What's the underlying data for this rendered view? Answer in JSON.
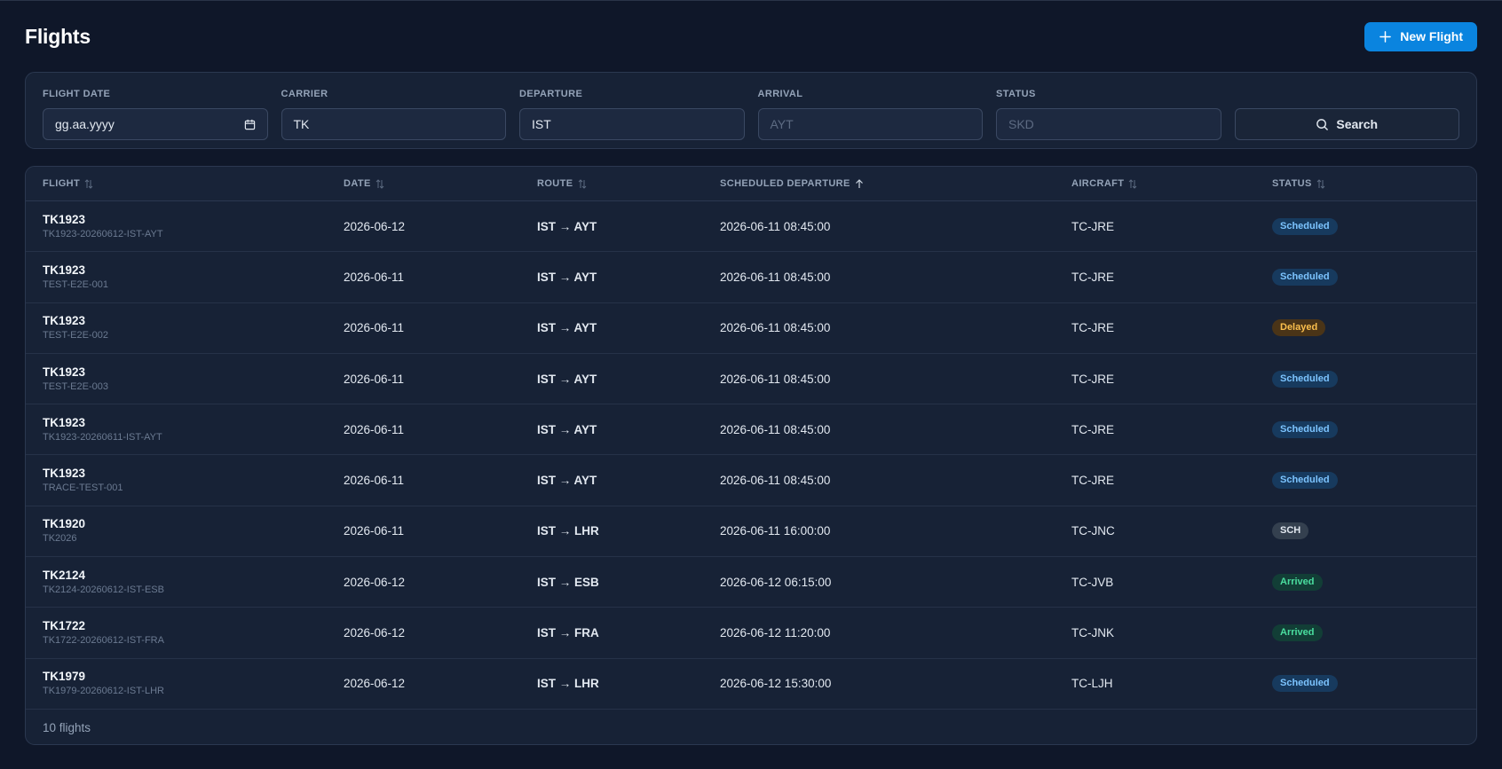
{
  "header": {
    "title": "Flights",
    "new_button": "New Flight"
  },
  "filters": {
    "flight_date": {
      "label": "FLIGHT DATE",
      "value": "gg.aa.yyyy"
    },
    "carrier": {
      "label": "CARRIER",
      "value": "TK"
    },
    "departure": {
      "label": "DEPARTURE",
      "value": "IST"
    },
    "arrival": {
      "label": "ARRIVAL",
      "placeholder": "AYT"
    },
    "status": {
      "label": "STATUS",
      "placeholder": "SKD"
    },
    "search_button": "Search"
  },
  "table": {
    "columns": [
      "FLIGHT",
      "DATE",
      "ROUTE",
      "SCHEDULED DEPARTURE",
      "AIRCRAFT",
      "STATUS"
    ],
    "rows": [
      {
        "flight": "TK1923",
        "id": "TK1923-20260612-IST-AYT",
        "date": "2026-06-12",
        "route": "IST → AYT",
        "departure": "2026-06-11 08:45:00",
        "aircraft": "TC-JRE",
        "status": "Scheduled",
        "status_type": "scheduled"
      },
      {
        "flight": "TK1923",
        "id": "TEST-E2E-001",
        "date": "2026-06-11",
        "route": "IST → AYT",
        "departure": "2026-06-11 08:45:00",
        "aircraft": "TC-JRE",
        "status": "Scheduled",
        "status_type": "scheduled"
      },
      {
        "flight": "TK1923",
        "id": "TEST-E2E-002",
        "date": "2026-06-11",
        "route": "IST → AYT",
        "departure": "2026-06-11 08:45:00",
        "aircraft": "TC-JRE",
        "status": "Delayed",
        "status_type": "delayed"
      },
      {
        "flight": "TK1923",
        "id": "TEST-E2E-003",
        "date": "2026-06-11",
        "route": "IST → AYT",
        "departure": "2026-06-11 08:45:00",
        "aircraft": "TC-JRE",
        "status": "Scheduled",
        "status_type": "scheduled"
      },
      {
        "flight": "TK1923",
        "id": "TK1923-20260611-IST-AYT",
        "date": "2026-06-11",
        "route": "IST → AYT",
        "departure": "2026-06-11 08:45:00",
        "aircraft": "TC-JRE",
        "status": "Scheduled",
        "status_type": "scheduled"
      },
      {
        "flight": "TK1923",
        "id": "TRACE-TEST-001",
        "date": "2026-06-11",
        "route": "IST → AYT",
        "departure": "2026-06-11 08:45:00",
        "aircraft": "TC-JRE",
        "status": "Scheduled",
        "status_type": "scheduled"
      },
      {
        "flight": "TK1920",
        "id": "TK2026",
        "date": "2026-06-11",
        "route": "IST → LHR",
        "departure": "2026-06-11 16:00:00",
        "aircraft": "TC-JNC",
        "status": "SCH",
        "status_type": "sch"
      },
      {
        "flight": "TK2124",
        "id": "TK2124-20260612-IST-ESB",
        "date": "2026-06-12",
        "route": "IST → ESB",
        "departure": "2026-06-12 06:15:00",
        "aircraft": "TC-JVB",
        "status": "Arrived",
        "status_type": "arrived"
      },
      {
        "flight": "TK1722",
        "id": "TK1722-20260612-IST-FRA",
        "date": "2026-06-12",
        "route": "IST → FRA",
        "departure": "2026-06-12 11:20:00",
        "aircraft": "TC-JNK",
        "status": "Arrived",
        "status_type": "arrived"
      },
      {
        "flight": "TK1979",
        "id": "TK1979-20260612-IST-LHR",
        "date": "2026-06-12",
        "route": "IST → LHR",
        "departure": "2026-06-12 15:30:00",
        "aircraft": "TC-LJH",
        "status": "Scheduled",
        "status_type": "scheduled"
      }
    ],
    "footer": "10 flights"
  },
  "colors": {
    "background": "#0f1729",
    "panel": "#172236",
    "accent": "#0a84df",
    "scheduled": "#7cc4ff",
    "delayed": "#fbbf4d",
    "arrived": "#4ade9f"
  },
  "icons": {
    "new_button": "plus-icon",
    "date_input": "calendar-icon",
    "search_button": "search-icon",
    "sortable": "sort-icon",
    "sorted_asc": "arrow-up-icon"
  }
}
